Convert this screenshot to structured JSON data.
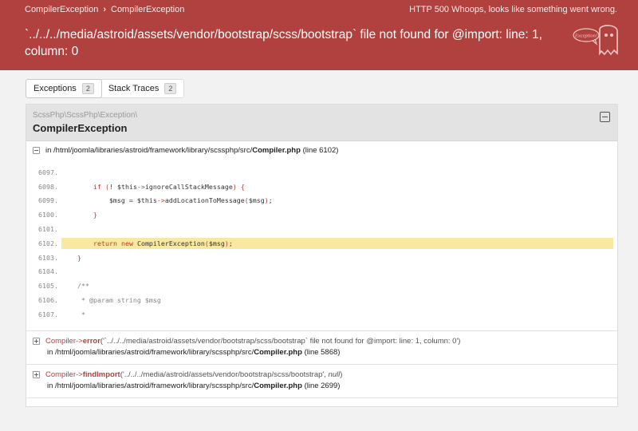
{
  "header": {
    "breadcrumb": [
      "CompilerException",
      "CompilerException"
    ],
    "status": "HTTP 500 Whoops, looks like something went wrong.",
    "message": "`../../../media/astroid/assets/vendor/bootstrap/scss/bootstrap` file not found for @import: line: 1, column: 0",
    "ghost_text": "Exception!",
    "colors": {
      "header_bg": "#b0413e",
      "highlight": "#f8e8a0"
    }
  },
  "tabs": [
    {
      "label": "Exceptions",
      "count": "2"
    },
    {
      "label": "Stack Traces",
      "count": "2"
    }
  ],
  "exception": {
    "namespace": "ScssPhp\\ScssPhp\\Exception\\",
    "class": "CompilerException",
    "location_prefix": "in /html/joomla/libraries/astroid/framework/library/scssphp/src/",
    "file": "Compiler.php",
    "line_info": "(line 6102)"
  },
  "code_lines": [
    {
      "n": "6097.",
      "t": ""
    },
    {
      "n": "6098.",
      "t": "        if (! $this->ignoreCallStackMessage) {"
    },
    {
      "n": "6099.",
      "t": "            $msg = $this->addLocationToMessage($msg);"
    },
    {
      "n": "6100.",
      "t": "        }"
    },
    {
      "n": "6101.",
      "t": ""
    },
    {
      "n": "6102.",
      "t": "        return new CompilerException($msg);"
    },
    {
      "n": "6103.",
      "t": "    }"
    },
    {
      "n": "6104.",
      "t": ""
    },
    {
      "n": "6105.",
      "t": "    /**"
    },
    {
      "n": "6106.",
      "t": "     * @param string $msg"
    },
    {
      "n": "6107.",
      "t": "     *"
    }
  ],
  "frames": [
    {
      "class": "Compiler",
      "arrow": "->",
      "method": "error",
      "args": "('`../../../media/astroid/assets/vendor/bootstrap/scss/bootstrap` file not found for @import: line: 1, column: 0')",
      "path": "in /html/joomla/libraries/astroid/framework/library/scssphp/src/",
      "file": "Compiler.php",
      "line": "(line 5868)"
    },
    {
      "class": "Compiler",
      "arrow": "->",
      "method": "findImport",
      "args_pre": "('../../../media/astroid/assets/vendor/bootstrap/scss/bootstrap', ",
      "args_null": "null",
      "args_post": ")",
      "path": "in /html/joomla/libraries/astroid/framework/library/scssphp/src/",
      "file": "Compiler.php",
      "line": "(line 2699)"
    }
  ]
}
